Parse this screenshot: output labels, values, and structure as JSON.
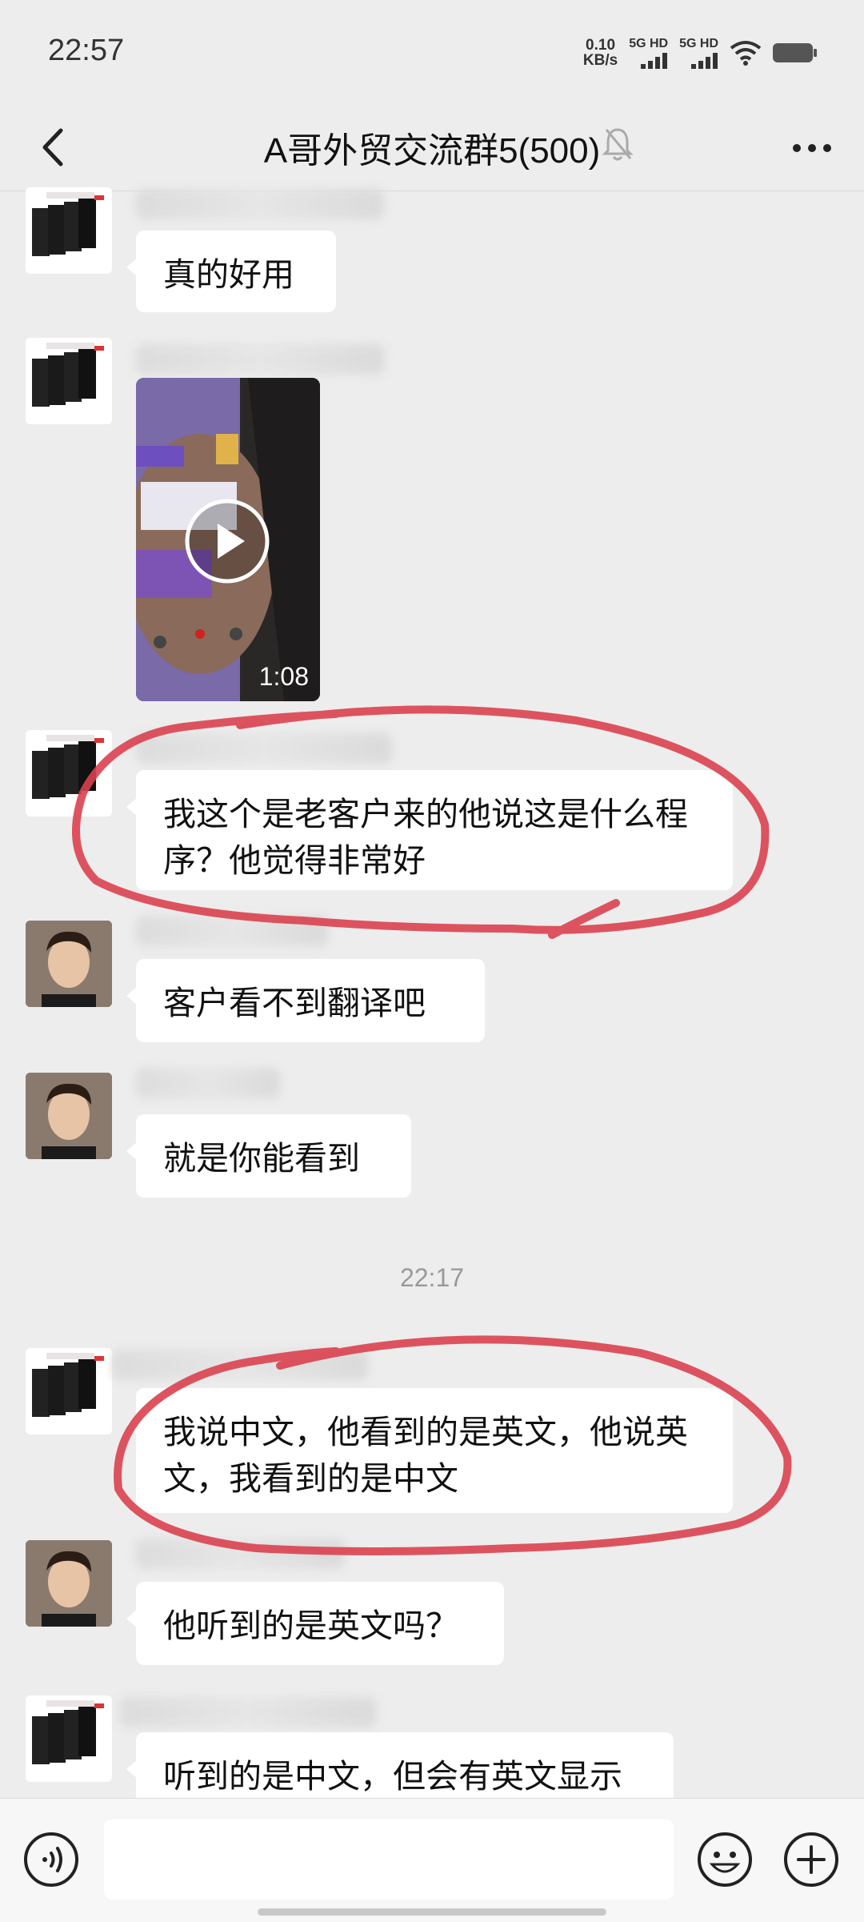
{
  "status_bar": {
    "time": "22:57",
    "net_speed_value": "0.10",
    "net_speed_unit": "KB/s",
    "signal1_label": "5G HD",
    "signal2_label": "5G HD"
  },
  "header": {
    "title": "A哥外贸交流群5(500)"
  },
  "messages": [
    {
      "text": "真的好用"
    },
    {
      "video_duration": "1:08"
    },
    {
      "text": "我这个是老客户来的他说这是什么程序？他觉得非常好"
    },
    {
      "text": "客户看不到翻译吧"
    },
    {
      "text": "就是你能看到"
    },
    {
      "text": "我说中文，他看到的是英文，他说英文，我看到的是中文"
    },
    {
      "text": "他听到的是英文吗？"
    },
    {
      "text": "听到的是中文，但会有英文显示"
    }
  ],
  "timestamp": "22:17",
  "colors": {
    "annotation": "#d9414f",
    "background": "#ededed",
    "bubble": "#ffffff"
  }
}
